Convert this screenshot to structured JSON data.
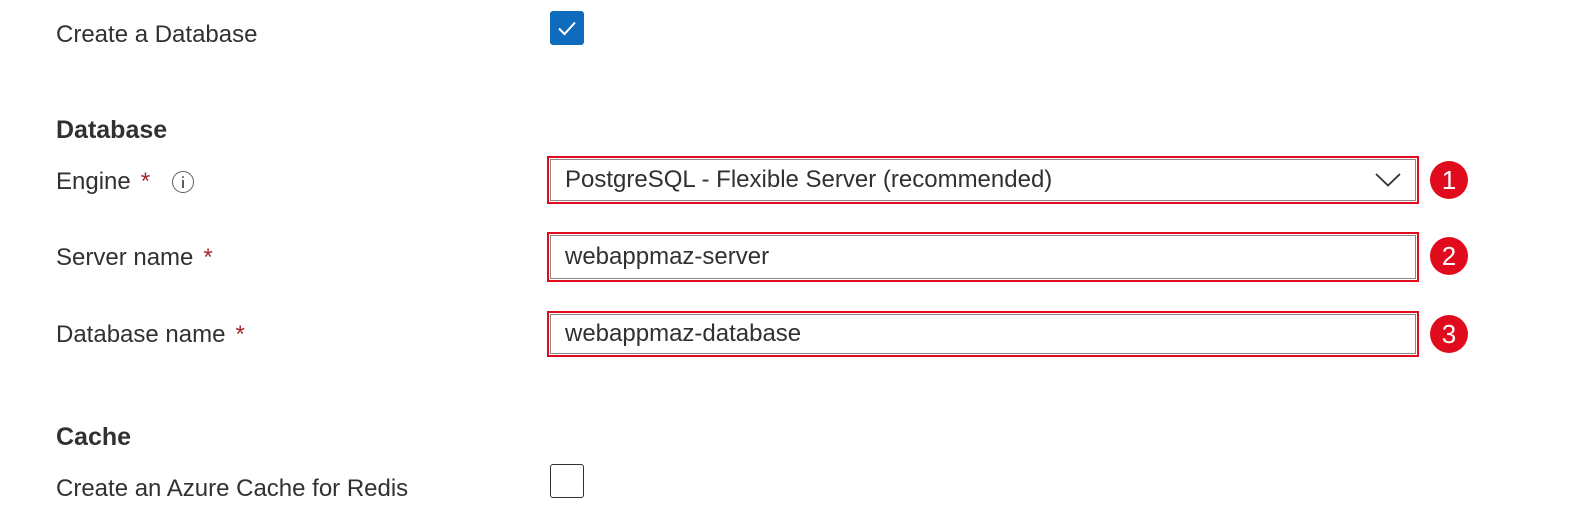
{
  "create_database": {
    "label": "Create a Database",
    "checked": true
  },
  "database_section": {
    "heading": "Database",
    "engine": {
      "label": "Engine",
      "required_marker": "*",
      "info_icon": "info-icon",
      "selected_value": "PostgreSQL - Flexible Server (recommended)",
      "callout": "1"
    },
    "server_name": {
      "label": "Server name",
      "required_marker": "*",
      "value": "webappmaz-server",
      "callout": "2"
    },
    "database_name": {
      "label": "Database name",
      "required_marker": "*",
      "value": "webappmaz-database",
      "callout": "3"
    }
  },
  "cache_section": {
    "heading": "Cache",
    "create_cache": {
      "label": "Create an Azure Cache for Redis",
      "checked": false
    }
  },
  "colors": {
    "accent_blue": "#0f6cbd",
    "highlight_red": "#e00b1c",
    "required_red": "#a4262c",
    "text": "#323130"
  }
}
